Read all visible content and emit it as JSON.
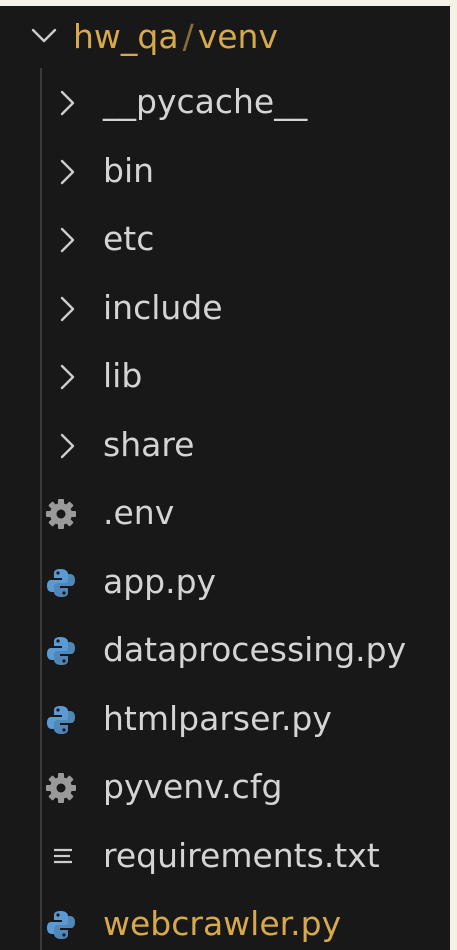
{
  "explorer": {
    "root": {
      "workspace": "hw_qa",
      "separator": "/",
      "folder": "venv",
      "expanded": true,
      "color": "#d8a94b"
    },
    "items": [
      {
        "label": "__pycache__",
        "type": "folder",
        "icon": "chevron-right-icon"
      },
      {
        "label": "bin",
        "type": "folder",
        "icon": "chevron-right-icon"
      },
      {
        "label": "etc",
        "type": "folder",
        "icon": "chevron-right-icon"
      },
      {
        "label": "include",
        "type": "folder",
        "icon": "chevron-right-icon"
      },
      {
        "label": "lib",
        "type": "folder",
        "icon": "chevron-right-icon"
      },
      {
        "label": "share",
        "type": "folder",
        "icon": "chevron-right-icon"
      },
      {
        "label": ".env",
        "type": "file",
        "icon": "gear-icon"
      },
      {
        "label": "app.py",
        "type": "file",
        "icon": "python-icon"
      },
      {
        "label": "dataprocessing.py",
        "type": "file",
        "icon": "python-icon"
      },
      {
        "label": "htmlparser.py",
        "type": "file",
        "icon": "python-icon"
      },
      {
        "label": "pyvenv.cfg",
        "type": "file",
        "icon": "gear-icon"
      },
      {
        "label": "requirements.txt",
        "type": "file",
        "icon": "text-lines-icon"
      },
      {
        "label": "webcrawler.py",
        "type": "file",
        "icon": "python-icon",
        "modified": true
      }
    ],
    "colors": {
      "background": "#181818",
      "text": "#d4d4d4",
      "modified": "#d8a94b",
      "python_icon": "#5b9bd5",
      "gear_icon": "#9a9a9a"
    }
  }
}
